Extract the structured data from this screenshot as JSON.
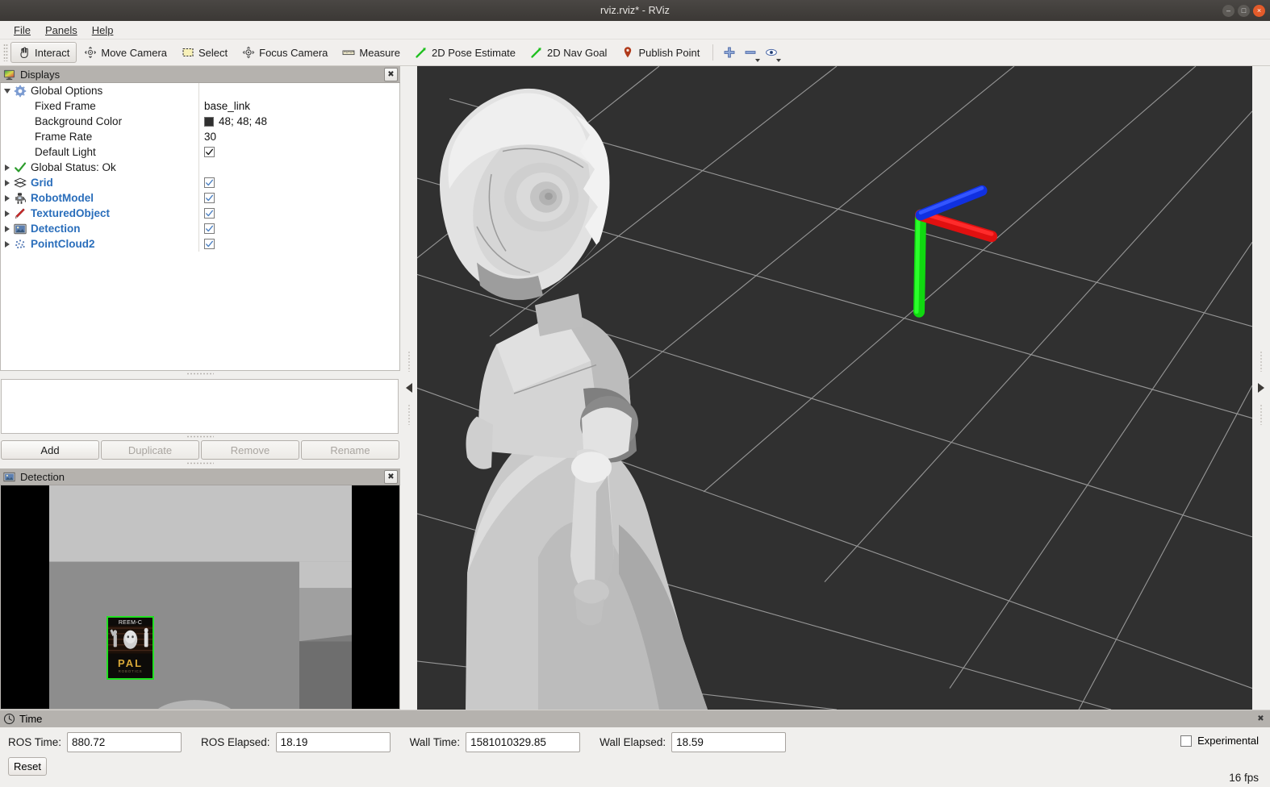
{
  "window": {
    "title": "rviz.rviz* - RViz",
    "controls": {
      "minimize": "–",
      "maximize": "□",
      "close": "×"
    }
  },
  "menubar": {
    "items": [
      {
        "label": "File",
        "mnemonic": "F"
      },
      {
        "label": "Panels",
        "mnemonic": "P"
      },
      {
        "label": "Help",
        "mnemonic": "H"
      }
    ]
  },
  "toolbar": {
    "tools": [
      {
        "label": "Interact",
        "icon": "hand-cursor-icon",
        "checked": true
      },
      {
        "label": "Move Camera",
        "icon": "move-camera-icon",
        "checked": false
      },
      {
        "label": "Select",
        "icon": "select-rect-icon",
        "checked": false
      },
      {
        "label": "Focus Camera",
        "icon": "focus-camera-icon",
        "checked": false
      },
      {
        "label": "Measure",
        "icon": "ruler-icon",
        "checked": false
      },
      {
        "label": "2D Pose Estimate",
        "icon": "green-arrow-icon",
        "checked": false
      },
      {
        "label": "2D Nav Goal",
        "icon": "green-arrow-icon",
        "checked": false
      },
      {
        "label": "Publish Point",
        "icon": "map-pin-icon",
        "checked": false
      }
    ],
    "icon_buttons": [
      {
        "name": "add-tool-button",
        "icon": "plus-icon",
        "has_menu": false
      },
      {
        "name": "remove-tool-button",
        "icon": "minus-icon",
        "has_menu": true
      },
      {
        "name": "tool-properties-button",
        "icon": "eye-icon",
        "has_menu": true
      }
    ]
  },
  "displays_panel": {
    "title": "Displays",
    "icon": "displays-monitor-icon",
    "close_label": "✖",
    "tree": [
      {
        "label": "Global Options",
        "icon": "gear-icon",
        "kind": "group",
        "expanded": true,
        "expander": "down",
        "style": "plain",
        "value_type": "none"
      },
      {
        "label": "Fixed Frame",
        "kind": "property",
        "style": "plain",
        "value_type": "text",
        "value": "base_link"
      },
      {
        "label": "Background Color",
        "kind": "property",
        "style": "plain",
        "value_type": "color",
        "value": "48; 48; 48",
        "color_hex": "#303030"
      },
      {
        "label": "Frame Rate",
        "kind": "property",
        "style": "plain",
        "value_type": "text",
        "value": "30"
      },
      {
        "label": "Default Light",
        "kind": "property",
        "style": "plain",
        "value_type": "checkbox",
        "checked": true,
        "check_color": "#141414"
      },
      {
        "label": "Global Status: Ok",
        "icon": "green-check-icon",
        "kind": "status",
        "expander": "right",
        "style": "plain",
        "value_type": "none"
      },
      {
        "label": "Grid",
        "icon": "grid-icon",
        "kind": "display",
        "expander": "right",
        "style": "display",
        "value_type": "checkbox",
        "checked": true,
        "check_color": "#4a7fc1"
      },
      {
        "label": "RobotModel",
        "icon": "robot-icon",
        "kind": "display",
        "expander": "right",
        "style": "display",
        "value_type": "checkbox",
        "checked": true,
        "check_color": "#4a7fc1"
      },
      {
        "label": "TexturedObject",
        "icon": "marker-pen-icon",
        "kind": "display",
        "expander": "right",
        "style": "display",
        "value_type": "checkbox",
        "checked": true,
        "check_color": "#4a7fc1"
      },
      {
        "label": "Detection",
        "icon": "image-display-icon",
        "kind": "display",
        "expander": "right",
        "style": "display",
        "value_type": "checkbox",
        "checked": true,
        "check_color": "#4a7fc1"
      },
      {
        "label": "PointCloud2",
        "icon": "pointcloud-icon",
        "kind": "display",
        "expander": "right",
        "style": "display",
        "value_type": "checkbox",
        "checked": true,
        "check_color": "#4a7fc1"
      }
    ],
    "buttons": [
      {
        "label": "Add",
        "enabled": true
      },
      {
        "label": "Duplicate",
        "enabled": false
      },
      {
        "label": "Remove",
        "enabled": false
      },
      {
        "label": "Rename",
        "enabled": false
      }
    ]
  },
  "detection_panel": {
    "title": "Detection",
    "icon": "image-display-icon",
    "close_label": "✖",
    "poster": {
      "title": "REEM-C",
      "brand": "PAL",
      "subtitle": "ROBOTICS",
      "bbox_color": "#22e022"
    }
  },
  "view3d": {
    "background_color": "#303030",
    "grid_color": "#a0a0a0",
    "axes": {
      "x_color": "#e01010",
      "y_color": "#10d810",
      "z_color": "#1030e0"
    },
    "robot_color": "#d8d8d8",
    "splitter_left_arrow": "◀",
    "splitter_right_arrow": "▶"
  },
  "time_panel": {
    "title": "Time",
    "icon": "clock-icon",
    "close_label": "✖",
    "fields": [
      {
        "label": "ROS Time:",
        "value": "880.72"
      },
      {
        "label": "ROS Elapsed:",
        "value": "18.19"
      },
      {
        "label": "Wall Time:",
        "value": "1581010329.85"
      },
      {
        "label": "Wall Elapsed:",
        "value": "18.59"
      }
    ],
    "reset_label": "Reset",
    "experimental_label": "Experimental",
    "experimental_checked": false,
    "fps": "16 fps"
  }
}
